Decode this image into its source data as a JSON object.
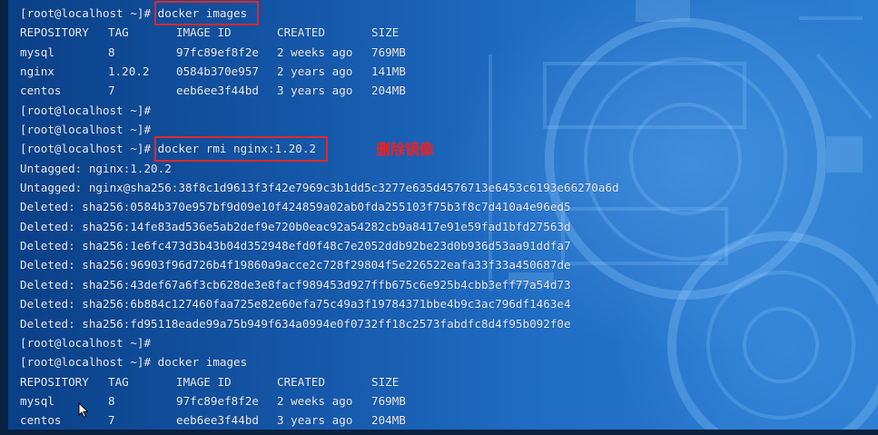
{
  "prompt": "[root@localhost ~]#",
  "command1": "docker images",
  "header": {
    "repo": "REPOSITORY",
    "tag": "TAG",
    "id": "IMAGE ID",
    "created": "CREATED",
    "size": "SIZE"
  },
  "images_before": [
    {
      "repo": "mysql",
      "tag": "8",
      "id": "97fc89ef8f2e",
      "created": "2 weeks ago",
      "size": "769MB"
    },
    {
      "repo": "nginx",
      "tag": "1.20.2",
      "id": "0584b370e957",
      "created": "2 years ago",
      "size": "141MB"
    },
    {
      "repo": "centos",
      "tag": "7",
      "id": "eeb6ee3f44bd",
      "created": "3 years ago",
      "size": "204MB"
    }
  ],
  "command2": "docker rmi nginx:1.20.2",
  "annotation": "删除镜像",
  "output_lines": [
    "Untagged: nginx:1.20.2",
    "Untagged: nginx@sha256:38f8c1d9613f3f42e7969c3b1dd5c3277e635d4576713e6453c6193e66270a6d",
    "Deleted: sha256:0584b370e957bf9d09e10f424859a02ab0fda255103f75b3f8c7d410a4e96ed5",
    "Deleted: sha256:14fe83ad536e5ab2def9e720b0eac92a54282cb9a8417e91e59fad1bfd27563d",
    "Deleted: sha256:1e6fc473d3b43b04d352948efd0f48c7e2052ddb92be23d0b936d53aa91ddfa7",
    "Deleted: sha256:96903f96d726b4f19860a9acce2c728f29804f5e226522eafa33f33a450687de",
    "Deleted: sha256:43def67a6f3cb628de3e8facf989453d927ffb675c6e925b4cbb3eff77a54d73",
    "Deleted: sha256:6b884c127460faa725e82e60efa75c49a3f19784371bbe4b9c3ac796df1463e4",
    "Deleted: sha256:fd95118eade99a75b949f634a0994e0f0732ff18c2573fabdfc8d4f95b092f0e"
  ],
  "command3": "docker images",
  "images_after": [
    {
      "repo": "mysql",
      "tag": "8",
      "id": "97fc89ef8f2e",
      "created": "2 weeks ago",
      "size": "769MB"
    },
    {
      "repo": "centos",
      "tag": "7",
      "id": "eeb6ee3f44bd",
      "created": "3 years ago",
      "size": "204MB"
    }
  ],
  "colors": {
    "highlight": "#e0282a",
    "annotation": "#e4242a",
    "text": "#e8f0ff",
    "background": "#1b62b3"
  },
  "icons": {
    "cursor": "mouse-pointer-icon"
  }
}
